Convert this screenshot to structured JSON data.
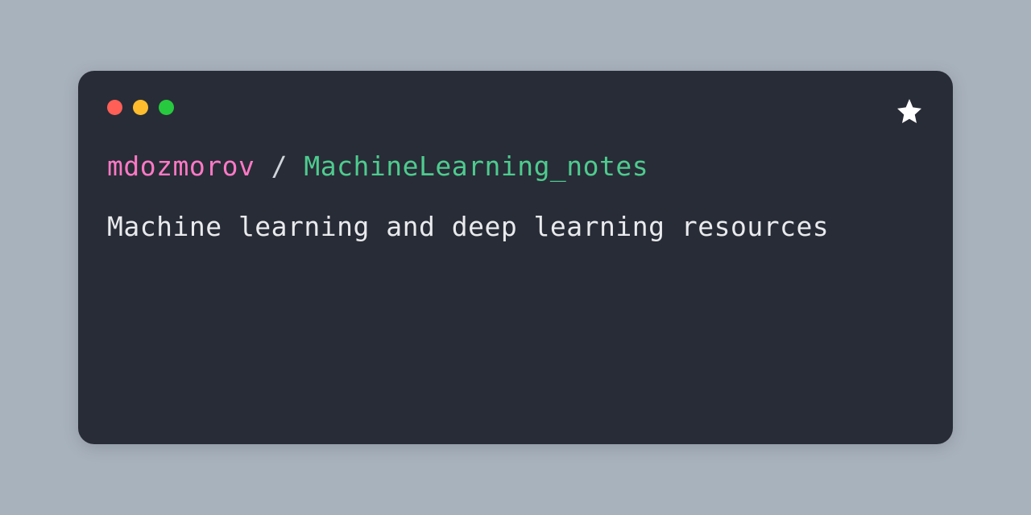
{
  "card": {
    "owner": "mdozmorov",
    "separator": " / ",
    "repo": "MachineLearning_notes",
    "description": "Machine learning and deep learning resources"
  }
}
